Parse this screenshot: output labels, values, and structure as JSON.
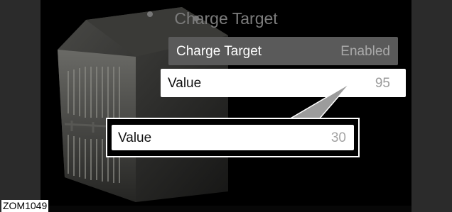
{
  "screen": {
    "title": "Charge Target",
    "setting": {
      "label": "Charge Target",
      "value": "Enabled"
    },
    "value_row": {
      "label": "Value",
      "value": "95"
    }
  },
  "zoom_callout": {
    "label": "Value",
    "value": "30"
  },
  "reference_code": "ZOM1049",
  "colors": {
    "screen_bg": "#000000",
    "setting_row_bg": "#5a5a5a",
    "highlight_row_bg": "#ffffff",
    "title_text": "#7c7c7c",
    "muted_value_text": "#a9a9a9",
    "bezel": "#2b2b2b"
  }
}
